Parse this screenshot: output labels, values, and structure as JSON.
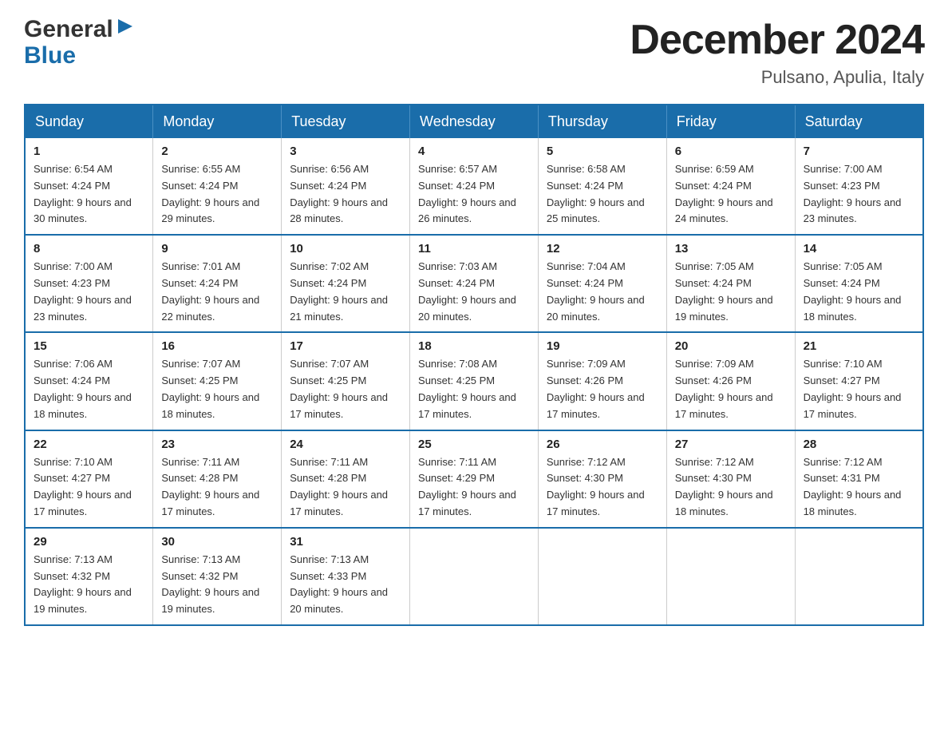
{
  "header": {
    "logo": {
      "general": "General",
      "blue": "Blue",
      "arrow": "▶"
    },
    "title": "December 2024",
    "location": "Pulsano, Apulia, Italy"
  },
  "days_of_week": [
    "Sunday",
    "Monday",
    "Tuesday",
    "Wednesday",
    "Thursday",
    "Friday",
    "Saturday"
  ],
  "weeks": [
    [
      {
        "day": "1",
        "sunrise": "Sunrise: 6:54 AM",
        "sunset": "Sunset: 4:24 PM",
        "daylight": "Daylight: 9 hours and 30 minutes."
      },
      {
        "day": "2",
        "sunrise": "Sunrise: 6:55 AM",
        "sunset": "Sunset: 4:24 PM",
        "daylight": "Daylight: 9 hours and 29 minutes."
      },
      {
        "day": "3",
        "sunrise": "Sunrise: 6:56 AM",
        "sunset": "Sunset: 4:24 PM",
        "daylight": "Daylight: 9 hours and 28 minutes."
      },
      {
        "day": "4",
        "sunrise": "Sunrise: 6:57 AM",
        "sunset": "Sunset: 4:24 PM",
        "daylight": "Daylight: 9 hours and 26 minutes."
      },
      {
        "day": "5",
        "sunrise": "Sunrise: 6:58 AM",
        "sunset": "Sunset: 4:24 PM",
        "daylight": "Daylight: 9 hours and 25 minutes."
      },
      {
        "day": "6",
        "sunrise": "Sunrise: 6:59 AM",
        "sunset": "Sunset: 4:24 PM",
        "daylight": "Daylight: 9 hours and 24 minutes."
      },
      {
        "day": "7",
        "sunrise": "Sunrise: 7:00 AM",
        "sunset": "Sunset: 4:23 PM",
        "daylight": "Daylight: 9 hours and 23 minutes."
      }
    ],
    [
      {
        "day": "8",
        "sunrise": "Sunrise: 7:00 AM",
        "sunset": "Sunset: 4:23 PM",
        "daylight": "Daylight: 9 hours and 23 minutes."
      },
      {
        "day": "9",
        "sunrise": "Sunrise: 7:01 AM",
        "sunset": "Sunset: 4:24 PM",
        "daylight": "Daylight: 9 hours and 22 minutes."
      },
      {
        "day": "10",
        "sunrise": "Sunrise: 7:02 AM",
        "sunset": "Sunset: 4:24 PM",
        "daylight": "Daylight: 9 hours and 21 minutes."
      },
      {
        "day": "11",
        "sunrise": "Sunrise: 7:03 AM",
        "sunset": "Sunset: 4:24 PM",
        "daylight": "Daylight: 9 hours and 20 minutes."
      },
      {
        "day": "12",
        "sunrise": "Sunrise: 7:04 AM",
        "sunset": "Sunset: 4:24 PM",
        "daylight": "Daylight: 9 hours and 20 minutes."
      },
      {
        "day": "13",
        "sunrise": "Sunrise: 7:05 AM",
        "sunset": "Sunset: 4:24 PM",
        "daylight": "Daylight: 9 hours and 19 minutes."
      },
      {
        "day": "14",
        "sunrise": "Sunrise: 7:05 AM",
        "sunset": "Sunset: 4:24 PM",
        "daylight": "Daylight: 9 hours and 18 minutes."
      }
    ],
    [
      {
        "day": "15",
        "sunrise": "Sunrise: 7:06 AM",
        "sunset": "Sunset: 4:24 PM",
        "daylight": "Daylight: 9 hours and 18 minutes."
      },
      {
        "day": "16",
        "sunrise": "Sunrise: 7:07 AM",
        "sunset": "Sunset: 4:25 PM",
        "daylight": "Daylight: 9 hours and 18 minutes."
      },
      {
        "day": "17",
        "sunrise": "Sunrise: 7:07 AM",
        "sunset": "Sunset: 4:25 PM",
        "daylight": "Daylight: 9 hours and 17 minutes."
      },
      {
        "day": "18",
        "sunrise": "Sunrise: 7:08 AM",
        "sunset": "Sunset: 4:25 PM",
        "daylight": "Daylight: 9 hours and 17 minutes."
      },
      {
        "day": "19",
        "sunrise": "Sunrise: 7:09 AM",
        "sunset": "Sunset: 4:26 PM",
        "daylight": "Daylight: 9 hours and 17 minutes."
      },
      {
        "day": "20",
        "sunrise": "Sunrise: 7:09 AM",
        "sunset": "Sunset: 4:26 PM",
        "daylight": "Daylight: 9 hours and 17 minutes."
      },
      {
        "day": "21",
        "sunrise": "Sunrise: 7:10 AM",
        "sunset": "Sunset: 4:27 PM",
        "daylight": "Daylight: 9 hours and 17 minutes."
      }
    ],
    [
      {
        "day": "22",
        "sunrise": "Sunrise: 7:10 AM",
        "sunset": "Sunset: 4:27 PM",
        "daylight": "Daylight: 9 hours and 17 minutes."
      },
      {
        "day": "23",
        "sunrise": "Sunrise: 7:11 AM",
        "sunset": "Sunset: 4:28 PM",
        "daylight": "Daylight: 9 hours and 17 minutes."
      },
      {
        "day": "24",
        "sunrise": "Sunrise: 7:11 AM",
        "sunset": "Sunset: 4:28 PM",
        "daylight": "Daylight: 9 hours and 17 minutes."
      },
      {
        "day": "25",
        "sunrise": "Sunrise: 7:11 AM",
        "sunset": "Sunset: 4:29 PM",
        "daylight": "Daylight: 9 hours and 17 minutes."
      },
      {
        "day": "26",
        "sunrise": "Sunrise: 7:12 AM",
        "sunset": "Sunset: 4:30 PM",
        "daylight": "Daylight: 9 hours and 17 minutes."
      },
      {
        "day": "27",
        "sunrise": "Sunrise: 7:12 AM",
        "sunset": "Sunset: 4:30 PM",
        "daylight": "Daylight: 9 hours and 18 minutes."
      },
      {
        "day": "28",
        "sunrise": "Sunrise: 7:12 AM",
        "sunset": "Sunset: 4:31 PM",
        "daylight": "Daylight: 9 hours and 18 minutes."
      }
    ],
    [
      {
        "day": "29",
        "sunrise": "Sunrise: 7:13 AM",
        "sunset": "Sunset: 4:32 PM",
        "daylight": "Daylight: 9 hours and 19 minutes."
      },
      {
        "day": "30",
        "sunrise": "Sunrise: 7:13 AM",
        "sunset": "Sunset: 4:32 PM",
        "daylight": "Daylight: 9 hours and 19 minutes."
      },
      {
        "day": "31",
        "sunrise": "Sunrise: 7:13 AM",
        "sunset": "Sunset: 4:33 PM",
        "daylight": "Daylight: 9 hours and 20 minutes."
      },
      null,
      null,
      null,
      null
    ]
  ]
}
